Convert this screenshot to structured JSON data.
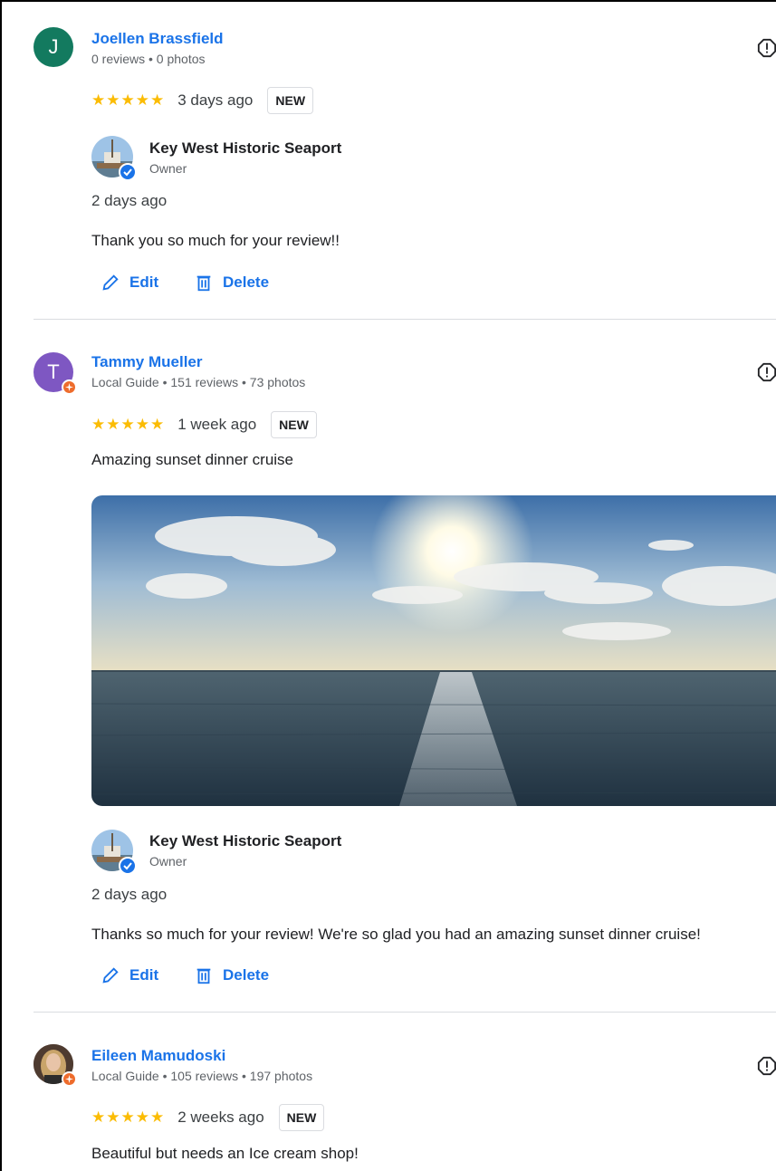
{
  "reviews": [
    {
      "avatar_letter": "J",
      "avatar_color": "#137a5f",
      "name": "Joellen Brassfield",
      "meta": "0 reviews • 0 photos",
      "stars": "★★★★★",
      "ago": "3 days ago",
      "badge": "NEW",
      "text": "",
      "reply": {
        "business": "Key West Historic Seaport",
        "role": "Owner",
        "ago": "2 days ago",
        "text": "Thank you so much for your review!!"
      }
    },
    {
      "avatar_letter": "T",
      "avatar_color": "#7e57c2",
      "name": "Tammy Mueller",
      "meta": "Local Guide • 151 reviews • 73 photos",
      "stars": "★★★★★",
      "ago": "1 week ago",
      "badge": "NEW",
      "text": "Amazing sunset dinner cruise",
      "reply": {
        "business": "Key West Historic Seaport",
        "role": "Owner",
        "ago": "2 days ago",
        "text": "Thanks so much for your review! We're so glad you had an amazing sunset dinner cruise!"
      }
    },
    {
      "avatar_letter": "",
      "avatar_color": "#6d4c41",
      "name": "Eileen Mamudoski",
      "meta": "Local Guide • 105 reviews • 197 photos",
      "stars": "★★★★★",
      "ago": "2 weeks ago",
      "badge": "NEW",
      "text": "Beautiful but needs an Ice cream shop!"
    }
  ],
  "actions": {
    "edit": "Edit",
    "delete": "Delete"
  },
  "colors": {
    "link": "#1a73e8",
    "star": "#fbbc04",
    "guide_badge": "#ee6c2c"
  }
}
